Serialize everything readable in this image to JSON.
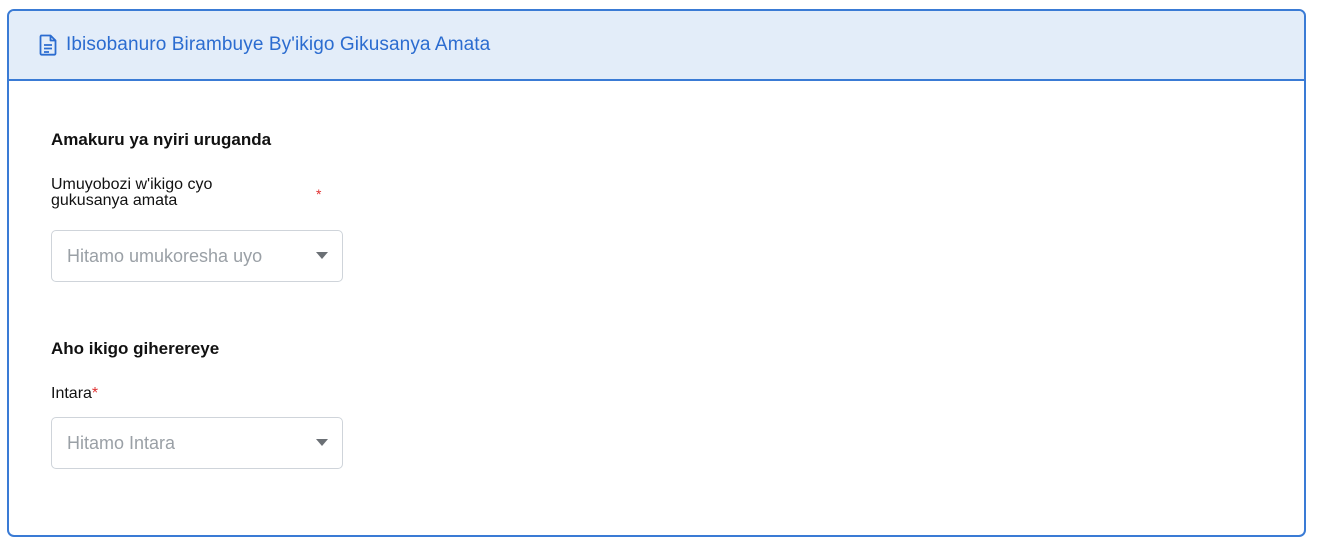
{
  "header": {
    "title": "Ibisobanuro Birambuye By'ikigo Gikusanya Amata",
    "icon": "document-icon"
  },
  "owner_section": {
    "heading": "Amakuru ya nyiri uruganda",
    "manager_label_line1": "Umuyobozi w'ikigo cyo",
    "manager_label_line2": "gukusanya amata",
    "required_mark": "*",
    "manager_select_placeholder": "Hitamo umukoresha uyo"
  },
  "location_section": {
    "heading": "Aho ikigo giherereye",
    "province_label": "Intara",
    "required_mark": "*",
    "province_select_placeholder": "Hitamo Intara"
  },
  "colors": {
    "accent": "#2b6cd0",
    "border": "#3a7bd5",
    "header_bg": "#e3edf9",
    "required": "#e03131",
    "placeholder": "#9aa0a6"
  }
}
